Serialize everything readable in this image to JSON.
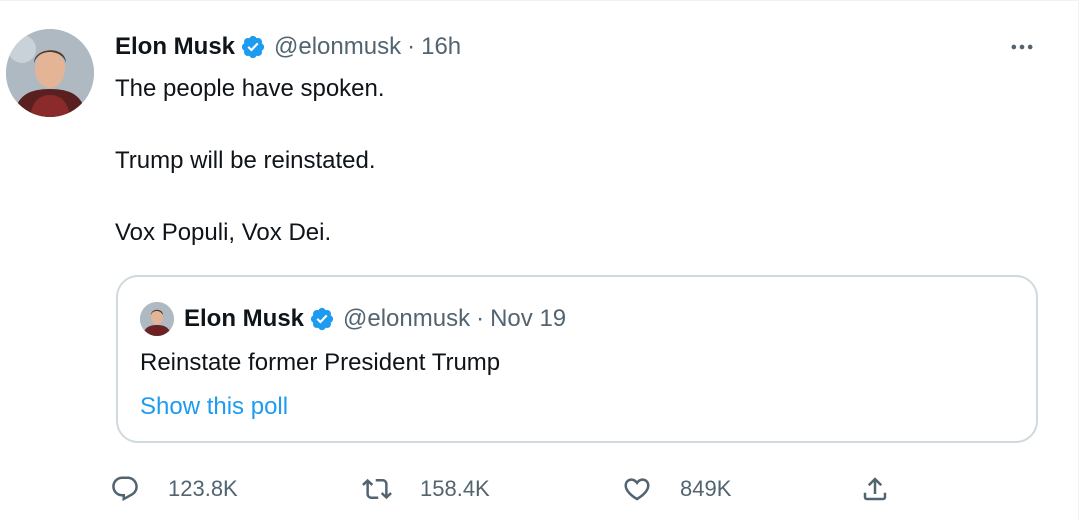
{
  "tweet": {
    "author_name": "Elon Musk",
    "handle": "@elonmusk",
    "separator": "·",
    "time": "16h",
    "lines": [
      "The people have spoken.",
      "",
      "Trump will be reinstated.",
      "",
      "Vox Populi, Vox Dei."
    ]
  },
  "quoted": {
    "author_name": "Elon Musk",
    "handle": "@elonmusk",
    "separator": "·",
    "date": "Nov 19",
    "text": "Reinstate former President Trump",
    "link_label": "Show this poll"
  },
  "actions": {
    "replies": "123.8K",
    "retweets": "158.4K",
    "likes": "849K"
  },
  "colors": {
    "verified_badge": "#1d9bf0",
    "link": "#1d9bf0",
    "secondary_text": "#536471"
  },
  "icons": {
    "more": "more-horizontal-icon",
    "reply": "reply-icon",
    "retweet": "retweet-icon",
    "like": "heart-icon",
    "share": "share-icon",
    "verified": "verified-badge-icon"
  }
}
